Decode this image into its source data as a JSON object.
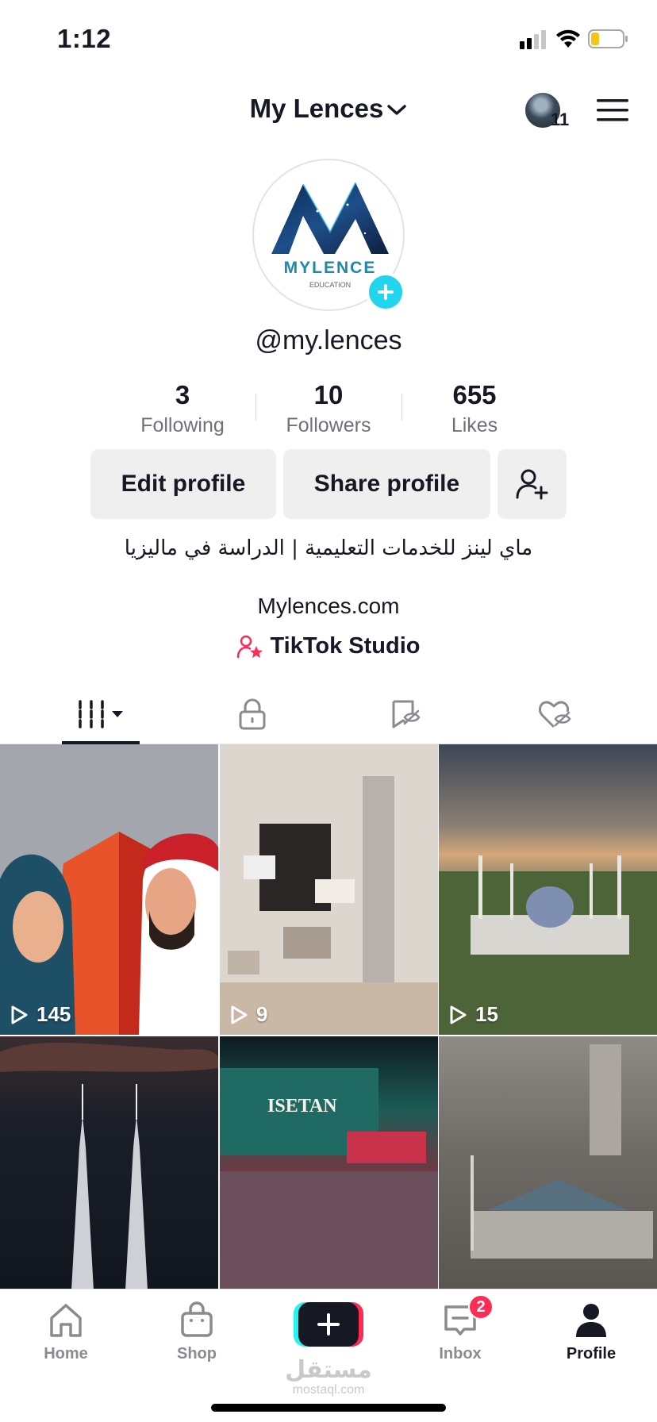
{
  "status_bar": {
    "time": "1:12",
    "battery_color": "#f5c518"
  },
  "header": {
    "title": "My Lences",
    "avatar_count": "11"
  },
  "profile": {
    "avatar_logo_text": "MYLENCE",
    "avatar_logo_subtext": "EDUCATION",
    "username": "@my.lences",
    "stats": [
      {
        "value": "3",
        "label": "Following"
      },
      {
        "value": "10",
        "label": "Followers"
      },
      {
        "value": "655",
        "label": "Likes"
      }
    ],
    "buttons": {
      "edit": "Edit profile",
      "share": "Share profile"
    },
    "bio": "ماي لينز للخدمات التعليمية | الدراسة في ماليزيا",
    "link": "Mylences.com",
    "studio": "TikTok Studio"
  },
  "tabs": [
    "videos-grid-icon",
    "lock-icon",
    "repost-icon",
    "liked-heart-icon"
  ],
  "videos": [
    {
      "views": "145"
    },
    {
      "views": "9"
    },
    {
      "views": "15"
    },
    {
      "views": ""
    },
    {
      "views": ""
    },
    {
      "views": ""
    }
  ],
  "grid_labels": {
    "isetan": "ISETAN"
  },
  "nav": {
    "home": "Home",
    "shop": "Shop",
    "inbox": "Inbox",
    "inbox_badge": "2",
    "profile": "Profile"
  },
  "watermark": {
    "arabic": "مستقل",
    "latin": "mostaql.com"
  },
  "colors": {
    "accent_cyan": "#20d5ec",
    "accent_red": "#fe2c55",
    "text": "#161823"
  }
}
